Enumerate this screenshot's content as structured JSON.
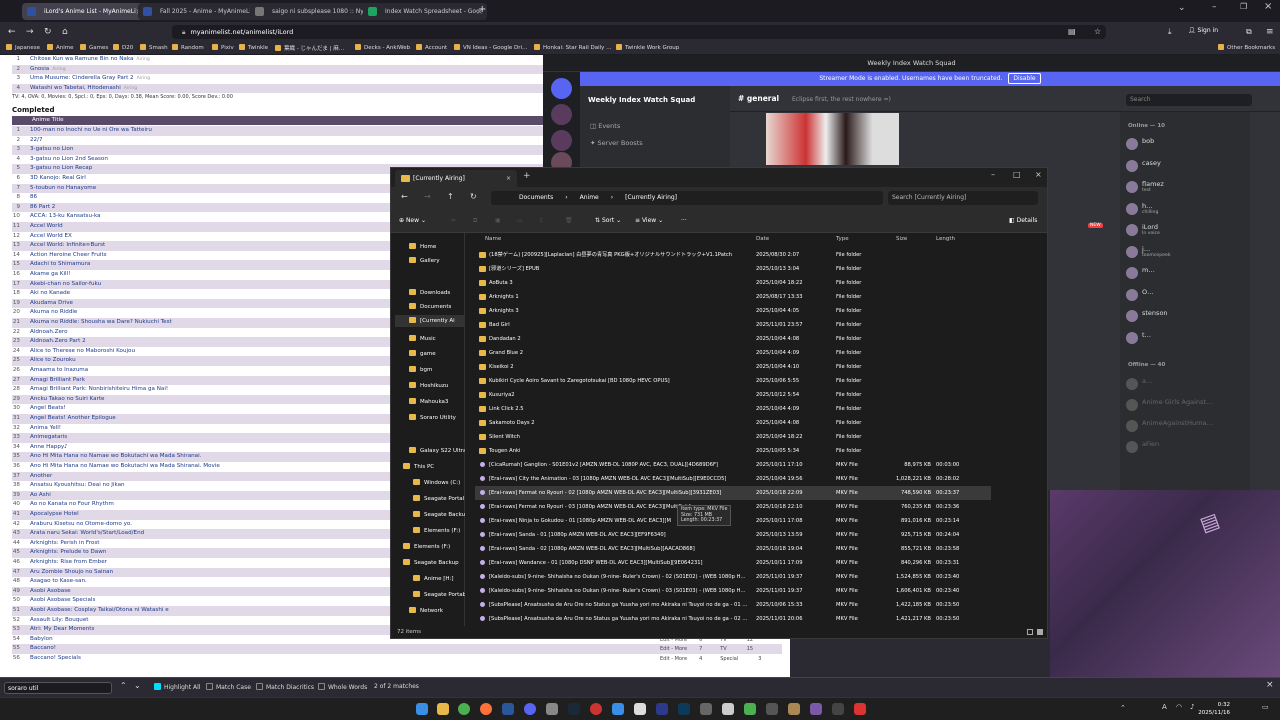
{
  "browser": {
    "tabs": [
      {
        "title": "iLord's Anime List - MyAnimeLi",
        "color": "#2e51a2",
        "active": true
      },
      {
        "title": "Fall 2025 - Anime - MyAnimeLis",
        "color": "#2e51a2",
        "active": false
      },
      {
        "title": "saigo ni subsplease 1080 :: Nya",
        "color": "#555555",
        "active": false
      },
      {
        "title": "Index Watch Spreadsheet - Goo",
        "color": "#1ea362",
        "active": false
      }
    ],
    "new_tab": "+",
    "url": "myanimelist.net/animelist/iLord",
    "sign_in": "Sign in",
    "bookmarks": [
      "Japanese",
      "Anime",
      "Games",
      "D20",
      "Smash",
      "Random",
      "Pixiv",
      "Twinkle",
      "葉織 - じゃんだま | 麻…",
      "Decks - AnkiWeb",
      "Account",
      "VN Ideas - Google Dri…",
      "Honkai: Star Rail Daily …",
      "Twinkle Work Group"
    ],
    "other_bookmarks": "Other Bookmarks"
  },
  "mal": {
    "top_rows": [
      {
        "num": "1",
        "title": "Chitose Kun wa Ramune Bin no Naka",
        "status": "Airing"
      },
      {
        "num": "2",
        "title": "Gnosia",
        "status": "Airing"
      },
      {
        "num": "3",
        "title": "Uma Musume: Cinderella Gray Part 2",
        "status": "Airing"
      },
      {
        "num": "4",
        "title": "Watashi wo Tabetai, Hitodenashi",
        "status": "Airing"
      }
    ],
    "stats1": "TV: 4, OVA: 0, Movies: 0, Spcl.: 0, Eps: 0, Days: 0.38, Mean Score: 0.00, Score Dev.: 0.00",
    "completed_heading": "Completed",
    "header_col": "Anime Title",
    "completed": [
      "100-man no Inochi no Ue ni Ore wa Tatteiru",
      "22/7",
      "3-gatsu no Lion",
      "3-gatsu no Lion 2nd Season",
      "3-gatsu no Lion Recap",
      "3D Kanojo: Real Girl",
      "5-toubun no Hanayome",
      "86",
      "86 Part 2",
      "ACCA: 13-ku Kansatsu-ka",
      "Accel World",
      "Accel World EX",
      "Accel World: Infinite∞Burst",
      "Action Heroine Cheer Fruits",
      "Adachi to Shimamura",
      "Akame ga Kill!",
      "Akebi-chan no Sailor-fuku",
      "Aki no Kanade",
      "Akudama Drive",
      "Akuma no Riddle",
      "Akuma no Riddle: Shousha wa Dare? Nukiuchi Test",
      "Aldnoah.Zero",
      "Aldnoah.Zero Part 2",
      "Alice to Therese no Maboroshi Koujou",
      "Alice to Zouroku",
      "Amaama to Inazuma",
      "Amagi Brilliant Park",
      "Amagi Brilliant Park: Nonbirishiteiru Hima ga Nai!",
      "Ancku Takao no Suiri Karte",
      "Angel Beats!",
      "Angel Beats! Another Epilogue",
      "Anima Yell!",
      "Animegataris",
      "Anne Happy♪",
      "Ano Hi Mita Hana no Namae wo Bokutachi wa Mada Shiranai.",
      "Ano Hi Mita Hana no Namae wo Bokutachi wa Mada Shiranai. Movie",
      "Another",
      "Ansatsu Kyoushitsu: Deai no Jikan",
      "Ao Ashi",
      "Ao no Kanata no Four Rhythm",
      "Apocalypse Hotel",
      "Araburu Kisetsu no Otome-domo yo.",
      "Arata naru Sekai: World's/Start/Load/End",
      "Arknights: Perish in Frost",
      "Arknights: Prelude to Dawn",
      "Arknights: Rise from Ember",
      "Aru Zombie Shoujo no Sainan",
      "Asagao to Kase-san.",
      "Asobi Asobase",
      "Asobi Asobase Specials",
      "Asobi Asobase: Cosplay Taikai/Otona ni Watashi e",
      "Assault Lily: Bouquet",
      "Atri: My Dear Moments",
      "Babylon",
      "Baccano!",
      "Baccano! Specials"
    ],
    "right_cells": [
      {
        "edit": "Edit - More",
        "score": "5",
        "type": "TV",
        "eps": "13"
      },
      {
        "edit": "Edit - More",
        "score": "6",
        "type": "TV",
        "eps": "12"
      },
      {
        "edit": "Edit - More",
        "score": "7",
        "type": "TV",
        "eps": "15"
      },
      {
        "edit": "Edit - More",
        "score": "4",
        "type": "Special",
        "eps": "3"
      }
    ]
  },
  "find": {
    "query": "soraro util",
    "highlight_all": "Highlight All",
    "match_case": "Match Case",
    "match_diacritics": "Match Diacritics",
    "whole_words": "Whole Words",
    "result": "2 of 2 matches"
  },
  "discord": {
    "window_title": "Weekly Index Watch Squad",
    "banner": "Streamer Mode is enabled. Usernames have been truncated.",
    "banner_btn": "Disable",
    "server": "Weekly Index Watch Squad",
    "items": [
      "Events",
      "Server Boosts"
    ],
    "channel": "general",
    "topic": "Eclipse first, the rest nowhere =)",
    "search": "Search",
    "new_badge": "NEW",
    "online_header": "Online — 10",
    "online": [
      {
        "name": "bob",
        "status": ""
      },
      {
        "name": "casey",
        "status": ""
      },
      {
        "name": "flamez",
        "status": "test"
      },
      {
        "name": "h…",
        "status": "chilling"
      },
      {
        "name": "iLord",
        "status": "In voice"
      },
      {
        "name": "j…",
        "status": "toomcepeek"
      },
      {
        "name": "m…",
        "status": ""
      },
      {
        "name": "O…",
        "status": ""
      },
      {
        "name": "stenson",
        "status": ""
      },
      {
        "name": "t…",
        "status": ""
      }
    ],
    "offline_header": "Offline — 40",
    "offline": [
      {
        "name": "a…"
      },
      {
        "name": "Anime Girls Against…"
      },
      {
        "name": "AnimeAgainstHuma…"
      },
      {
        "name": "aFien"
      }
    ]
  },
  "explorer": {
    "tab_title": "[Currently Airing]",
    "path": [
      "Documents",
      "Anime",
      "[Currently Airing]"
    ],
    "search": "Search [Currently Airing]",
    "tools": {
      "new": "New",
      "sort": "Sort",
      "view": "View",
      "more": "···",
      "details": "Details"
    },
    "nav": [
      {
        "label": "Home",
        "sel": false
      },
      {
        "label": "Gallery",
        "sel": false
      },
      {
        "label": "Downloads",
        "sel": false
      },
      {
        "label": "Documents",
        "sel": false
      },
      {
        "label": "[Currently Ai",
        "sel": true
      },
      {
        "label": "Music",
        "sel": false
      },
      {
        "label": "game",
        "sel": false
      },
      {
        "label": "bgm",
        "sel": false
      },
      {
        "label": "Hoshikuzu",
        "sel": false
      },
      {
        "label": "Mahouka3",
        "sel": false
      },
      {
        "label": "Soraro Utility",
        "sel": false
      },
      {
        "label": "Galaxy S22 Ultra",
        "sel": false
      },
      {
        "label": "This PC",
        "sel": false
      },
      {
        "label": "Windows (C:)",
        "sel": false
      },
      {
        "label": "Seagate Portal",
        "sel": false
      },
      {
        "label": "Seagate Backu",
        "sel": false
      },
      {
        "label": "Elements (F:)",
        "sel": false
      },
      {
        "label": "Elements (F:)",
        "sel": false
      },
      {
        "label": "Seagate Backup",
        "sel": false
      },
      {
        "label": "Anime [H:]",
        "sel": false
      },
      {
        "label": "Seagate Portabl",
        "sel": false
      },
      {
        "label": "Network",
        "sel": false
      }
    ],
    "columns": {
      "name": "Name",
      "date": "Date",
      "type": "Type",
      "size": "Size",
      "length": "Length"
    },
    "files": [
      {
        "k": "folder",
        "name": "(18禁ゲーム) [200925][Laplacian] 白昼夢の青写真 PKG版+オリジナルサウンドトラック+V1.1Patch",
        "date": "2025/08/30 2:07",
        "type": "File folder",
        "size": "",
        "len": ""
      },
      {
        "k": "folder",
        "name": "[邪道シリーズ] EPUB",
        "date": "2025/10/13 3:04",
        "type": "File folder",
        "size": "",
        "len": ""
      },
      {
        "k": "folder",
        "name": "AoButa 3",
        "date": "2025/10/04 18:22",
        "type": "File folder",
        "size": "",
        "len": ""
      },
      {
        "k": "folder",
        "name": "Arknights 1",
        "date": "2025/08/17 13:33",
        "type": "File folder",
        "size": "",
        "len": ""
      },
      {
        "k": "folder",
        "name": "Arknights 3",
        "date": "2025/10/04 4:05",
        "type": "File folder",
        "size": "",
        "len": ""
      },
      {
        "k": "folder",
        "name": "Bad Girl",
        "date": "2025/11/01 23:57",
        "type": "File folder",
        "size": "",
        "len": ""
      },
      {
        "k": "folder",
        "name": "Dandadan 2",
        "date": "2025/10/04 4:08",
        "type": "File folder",
        "size": "",
        "len": ""
      },
      {
        "k": "folder",
        "name": "Grand Blue 2",
        "date": "2025/10/04 4:09",
        "type": "File folder",
        "size": "",
        "len": ""
      },
      {
        "k": "folder",
        "name": "Kiseikoi 2",
        "date": "2025/10/04 4:10",
        "type": "File folder",
        "size": "",
        "len": ""
      },
      {
        "k": "folder",
        "name": "Kubikiri Cycle Aoiro Savant to Zaregototsukai [BD 1080p HEVC OPUS]",
        "date": "2025/10/06 5:55",
        "type": "File folder",
        "size": "",
        "len": ""
      },
      {
        "k": "folder",
        "name": "Kusuriya2",
        "date": "2025/10/12 5:54",
        "type": "File folder",
        "size": "",
        "len": ""
      },
      {
        "k": "folder",
        "name": "Link Click 2.5",
        "date": "2025/10/04 4:09",
        "type": "File folder",
        "size": "",
        "len": ""
      },
      {
        "k": "folder",
        "name": "Sakamoto Days 2",
        "date": "2025/10/04 4:08",
        "type": "File folder",
        "size": "",
        "len": ""
      },
      {
        "k": "folder",
        "name": "Silent Witch",
        "date": "2025/10/04 18:22",
        "type": "File folder",
        "size": "",
        "len": ""
      },
      {
        "k": "folder",
        "name": "Tougen Anki",
        "date": "2025/10/05 5:34",
        "type": "File folder",
        "size": "",
        "len": ""
      },
      {
        "k": "mkv",
        "name": "[CicaRumah] Ganglion - S01E01v2 [AMZN.WEB-DL 1080P AVC, EAC3, DUAL][4D689D6F]",
        "date": "2025/10/11 17:10",
        "type": "MKV File",
        "size": "88,975 KB",
        "len": "00:03:00"
      },
      {
        "k": "mkv",
        "name": "[Erai-raws] City the Animation - 03 [1080p AMZN WEB-DL AVC EAC3][MultiSub][E9E0CCD5]",
        "date": "2025/10/04 19:56",
        "type": "MKV File",
        "size": "1,028,221 KB",
        "len": "00:28:02"
      },
      {
        "k": "mkv",
        "name": "[Erai-raws] Fermat no Ryouri - 02 [1080p AMZN WEB-DL AVC EAC3][MultiSub][3931ZE03]",
        "date": "2025/10/18 22:09",
        "type": "MKV File",
        "size": "748,590 KB",
        "len": "00:23:37",
        "sel": true
      },
      {
        "k": "mkv",
        "name": "[Erai-raws] Fermat no Ryouri - 03 [1080p AMZN WEB-DL AVC EAC3][MultiSub]",
        "date": "2025/10/18 22:10",
        "type": "MKV File",
        "size": "760,235 KB",
        "len": "00:23:36"
      },
      {
        "k": "mkv",
        "name": "[Erai-raws] Ninja to Gokudou - 01 [1080p AMZN WEB-DL AVC EAC3][M",
        "date": "2025/10/11 17:08",
        "type": "MKV File",
        "size": "891,016 KB",
        "len": "00:23:14"
      },
      {
        "k": "mkv",
        "name": "[Erai-raws] Sanda - 01 [1080p AMZN WEB-DL AVC EAC3][EF9F6340]",
        "date": "2025/10/13 13:59",
        "type": "MKV File",
        "size": "925,715 KB",
        "len": "00:24:04"
      },
      {
        "k": "mkv",
        "name": "[Erai-raws] Sanda - 02 [1080p AMZN WEB-DL AVC EAC3][MultiSub][AACAD868]",
        "date": "2025/10/18 19:04",
        "type": "MKV File",
        "size": "855,721 KB",
        "len": "00:23:58"
      },
      {
        "k": "mkv",
        "name": "[Erai-raws] Wandance - 01 [1080p DSNP WEB-DL AVC EAC3][MultiSub][9E064231]",
        "date": "2025/10/11 17:09",
        "type": "MKV File",
        "size": "840,296 KB",
        "len": "00:23:31"
      },
      {
        "k": "mkv",
        "name": "[Kaleido-subs] 9-nine- Shihaisha no Oukan (9-nine- Ruler's Crown) - 02 (S01E02) - (WEB 1080p H…",
        "date": "2025/11/01 19:37",
        "type": "MKV File",
        "size": "1,524,855 KB",
        "len": "00:23:40"
      },
      {
        "k": "mkv",
        "name": "[Kaleido-subs] 9-nine- Shihaisha no Oukan (9-nine- Ruler's Crown) - 03 (S01E03) - (WEB 1080p H…",
        "date": "2025/11/01 19:37",
        "type": "MKV File",
        "size": "1,606,401 KB",
        "len": "00:23:40"
      },
      {
        "k": "mkv",
        "name": "[SubsPlease] Ansatsusha de Aru Ore no Status ga Yuusha yori mo Akiraka ni Tsuyoi no de ga - 01 …",
        "date": "2025/10/06 15:33",
        "type": "MKV File",
        "size": "1,422,185 KB",
        "len": "00:23:50"
      },
      {
        "k": "mkv",
        "name": "[SubsPlease] Ansatsusha de Aru Ore no Status ga Yuusha yori mo Akiraka ni Tsuyoi no de ga - 02 …",
        "date": "2025/11/01 20:06",
        "type": "MKV File",
        "size": "1,421,217 KB",
        "len": "00:23:50"
      }
    ],
    "tooltip": [
      "Item type: MKV File",
      "Size: 731 MB",
      "Length: 00:23:37"
    ],
    "status": "72 items"
  },
  "taskbar": {
    "time": "0:32",
    "date": "2025/11/16",
    "lang": "A"
  }
}
